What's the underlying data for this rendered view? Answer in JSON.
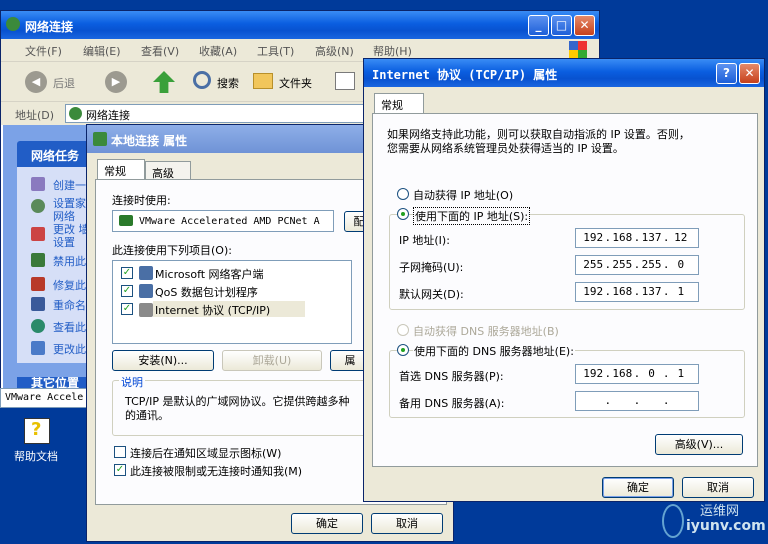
{
  "network_window": {
    "title": "网络连接",
    "menu": [
      "文件(F)",
      "编辑(E)",
      "查看(V)",
      "收藏(A)",
      "工具(T)",
      "高级(N)",
      "帮助(H)"
    ],
    "toolbar": {
      "back": "后退",
      "search": "搜索",
      "folders": "文件夹"
    },
    "address_label": "地址(D)",
    "address_value": "网络连接",
    "tasks_title": "网络任务",
    "tasks": [
      "创建一",
      "设置家 网络",
      "更改 墙设置",
      "禁用此",
      "修复此",
      "重命名",
      "查看此",
      "更改此"
    ],
    "other_places": "其它位置",
    "status_item": "VMware Accele"
  },
  "desktop": {
    "help_label": "帮助文档"
  },
  "local_props": {
    "title": "本地连接 属性",
    "tabs": [
      "常规",
      "高级"
    ],
    "connect_using_label": "连接时使用:",
    "adapter": "VMware Accelerated AMD PCNet A",
    "config_btn": "配",
    "items_label": "此连接使用下列项目(O):",
    "items": [
      "Microsoft 网络客户端",
      "QoS 数据包计划程序",
      "Internet 协议 (TCP/IP)"
    ],
    "install_btn": "安装(N)...",
    "uninstall_btn": "卸载(U)",
    "props_btn": "属",
    "desc_title": "说明",
    "desc_text1": "TCP/IP 是默认的广域网协议。它提供跨越多种",
    "desc_text2": "的通讯。",
    "show_icon": "连接后在通知区域显示图标(W)",
    "notify": "此连接被限制或无连接时通知我(M)",
    "ok": "确定",
    "cancel": "取消"
  },
  "tcpip": {
    "title": "Internet 协议 (TCP/IP) 属性",
    "tab": "常规",
    "info1": "如果网络支持此功能，则可以获取自动指派的 IP 设置。否则，",
    "info2": "您需要从网络系统管理员处获得适当的 IP 设置。",
    "auto_ip": "自动获得 IP 地址(O)",
    "manual_ip": "使用下面的 IP 地址(S):",
    "ip_label": "IP 地址(I):",
    "ip": [
      "192",
      "168",
      "137",
      "12"
    ],
    "mask_label": "子网掩码(U):",
    "mask": [
      "255",
      "255",
      "255",
      "0"
    ],
    "gw_label": "默认网关(D):",
    "gw": [
      "192",
      "168",
      "137",
      "1"
    ],
    "auto_dns": "自动获得 DNS 服务器地址(B)",
    "manual_dns": "使用下面的 DNS 服务器地址(E):",
    "dns1_label": "首选 DNS 服务器(P):",
    "dns1": [
      "192",
      "168",
      "0",
      "1"
    ],
    "dns2_label": "备用 DNS 服务器(A):",
    "dns2": [
      "",
      "",
      "",
      ""
    ],
    "advanced": "高级(V)...",
    "ok": "确定",
    "cancel": "取消"
  },
  "watermark": {
    "line1": "运维网",
    "line2": "iyunv.com"
  },
  "colors": {
    "desktop": "#003a9a",
    "title_blue": "#0a5ee0",
    "tasks_blue": "#215dc6"
  }
}
